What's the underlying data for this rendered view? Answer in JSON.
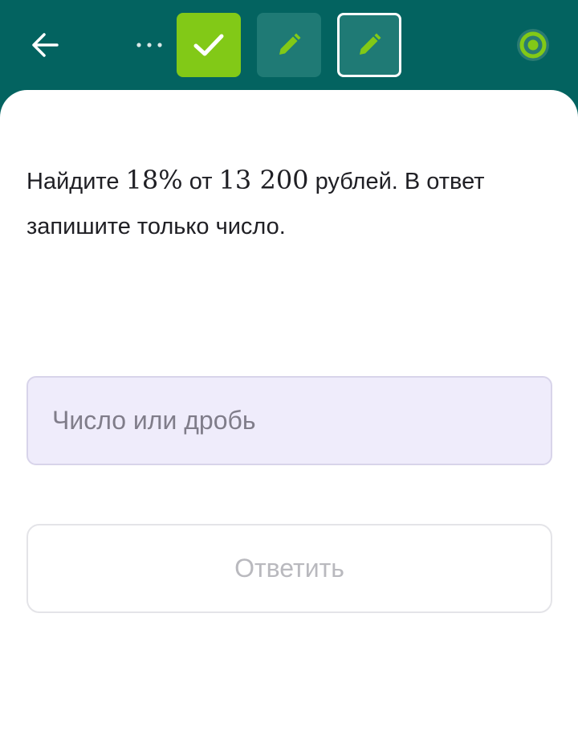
{
  "header": {
    "back_icon": "arrow-left-icon",
    "more_icon": "more-horizontal-icon",
    "progress_icon": "progress-ring-icon",
    "steps": [
      {
        "state": "done",
        "icon": "check-icon",
        "color": "#82c917"
      },
      {
        "state": "todo",
        "icon": "pencil-icon",
        "color": "#1f7a75"
      },
      {
        "state": "current",
        "icon": "pencil-icon",
        "color": "#1f7a75"
      }
    ],
    "background": "#036360",
    "accent": "#82c917"
  },
  "task": {
    "text_before_percent": "Найдите ",
    "percent": "18%",
    "text_middle": " от ",
    "amount": "13 200",
    "text_after": " рублей. В ответ запишите только число."
  },
  "answer": {
    "placeholder": "Число или дробь",
    "value": ""
  },
  "submit": {
    "label": "Ответить"
  }
}
